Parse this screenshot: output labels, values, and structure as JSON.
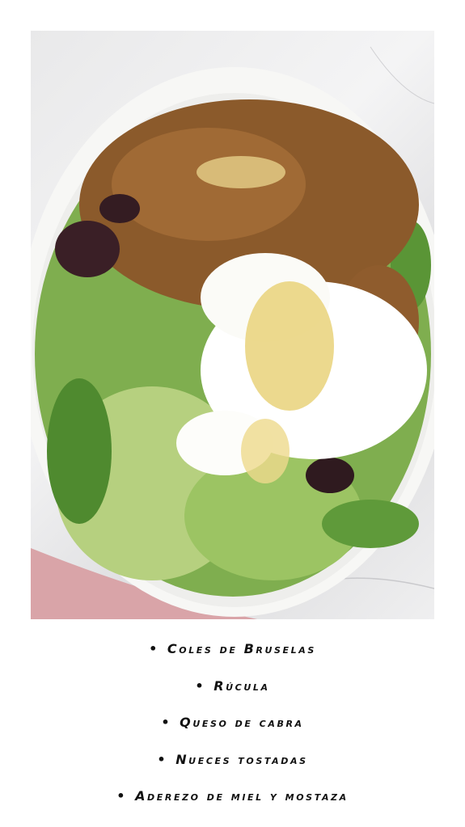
{
  "image": {
    "subject": "salad-bowl",
    "colors": {
      "bowl": "#f7f7f5",
      "greens": "#7fae4f",
      "pecans": "#8b5a2b",
      "cheese": "#ffffff",
      "cranberries": "#3a1f26",
      "dressing": "#e9d27a",
      "napkin": "#d9a4a8"
    }
  },
  "ingredients": [
    {
      "bullet": "•",
      "text": "Coles de Bruselas"
    },
    {
      "bullet": "•",
      "text": "Rúcula"
    },
    {
      "bullet": "•",
      "text": "Queso de cabra"
    },
    {
      "bullet": "•",
      "text": "Nueces tostadas"
    },
    {
      "bullet": "•",
      "text": "Aderezo de miel y mostaza"
    }
  ]
}
